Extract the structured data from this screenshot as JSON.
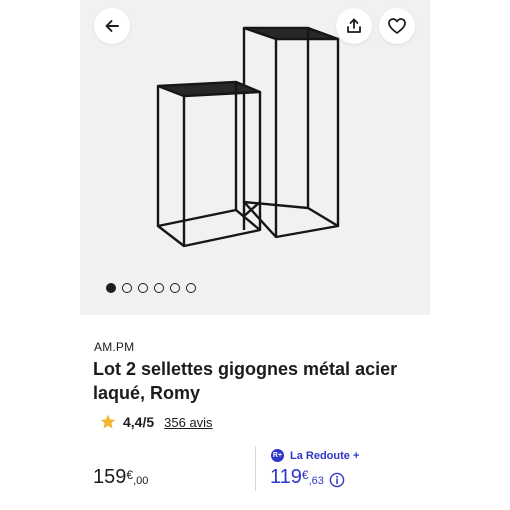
{
  "gallery": {
    "back_icon": "arrow-left-icon",
    "share_icon": "share-icon",
    "favorite_icon": "heart-icon",
    "image_count": 6,
    "active_index": 0
  },
  "product": {
    "brand": "AM.PM",
    "title": "Lot 2 sellettes gigognes métal acier laqué, Romy",
    "rating": "4,4/5",
    "reviews": "356 avis"
  },
  "price": {
    "standard": {
      "integer": "159",
      "currency": "€",
      "cents": ",00"
    },
    "member": {
      "program": "La Redoute +",
      "badge": "R+",
      "integer": "119",
      "currency": "€",
      "cents": ",63"
    }
  },
  "colors": {
    "accent": "#2e37c8",
    "star": "#f2b630",
    "gallery_bg": "#f2f1ef"
  }
}
